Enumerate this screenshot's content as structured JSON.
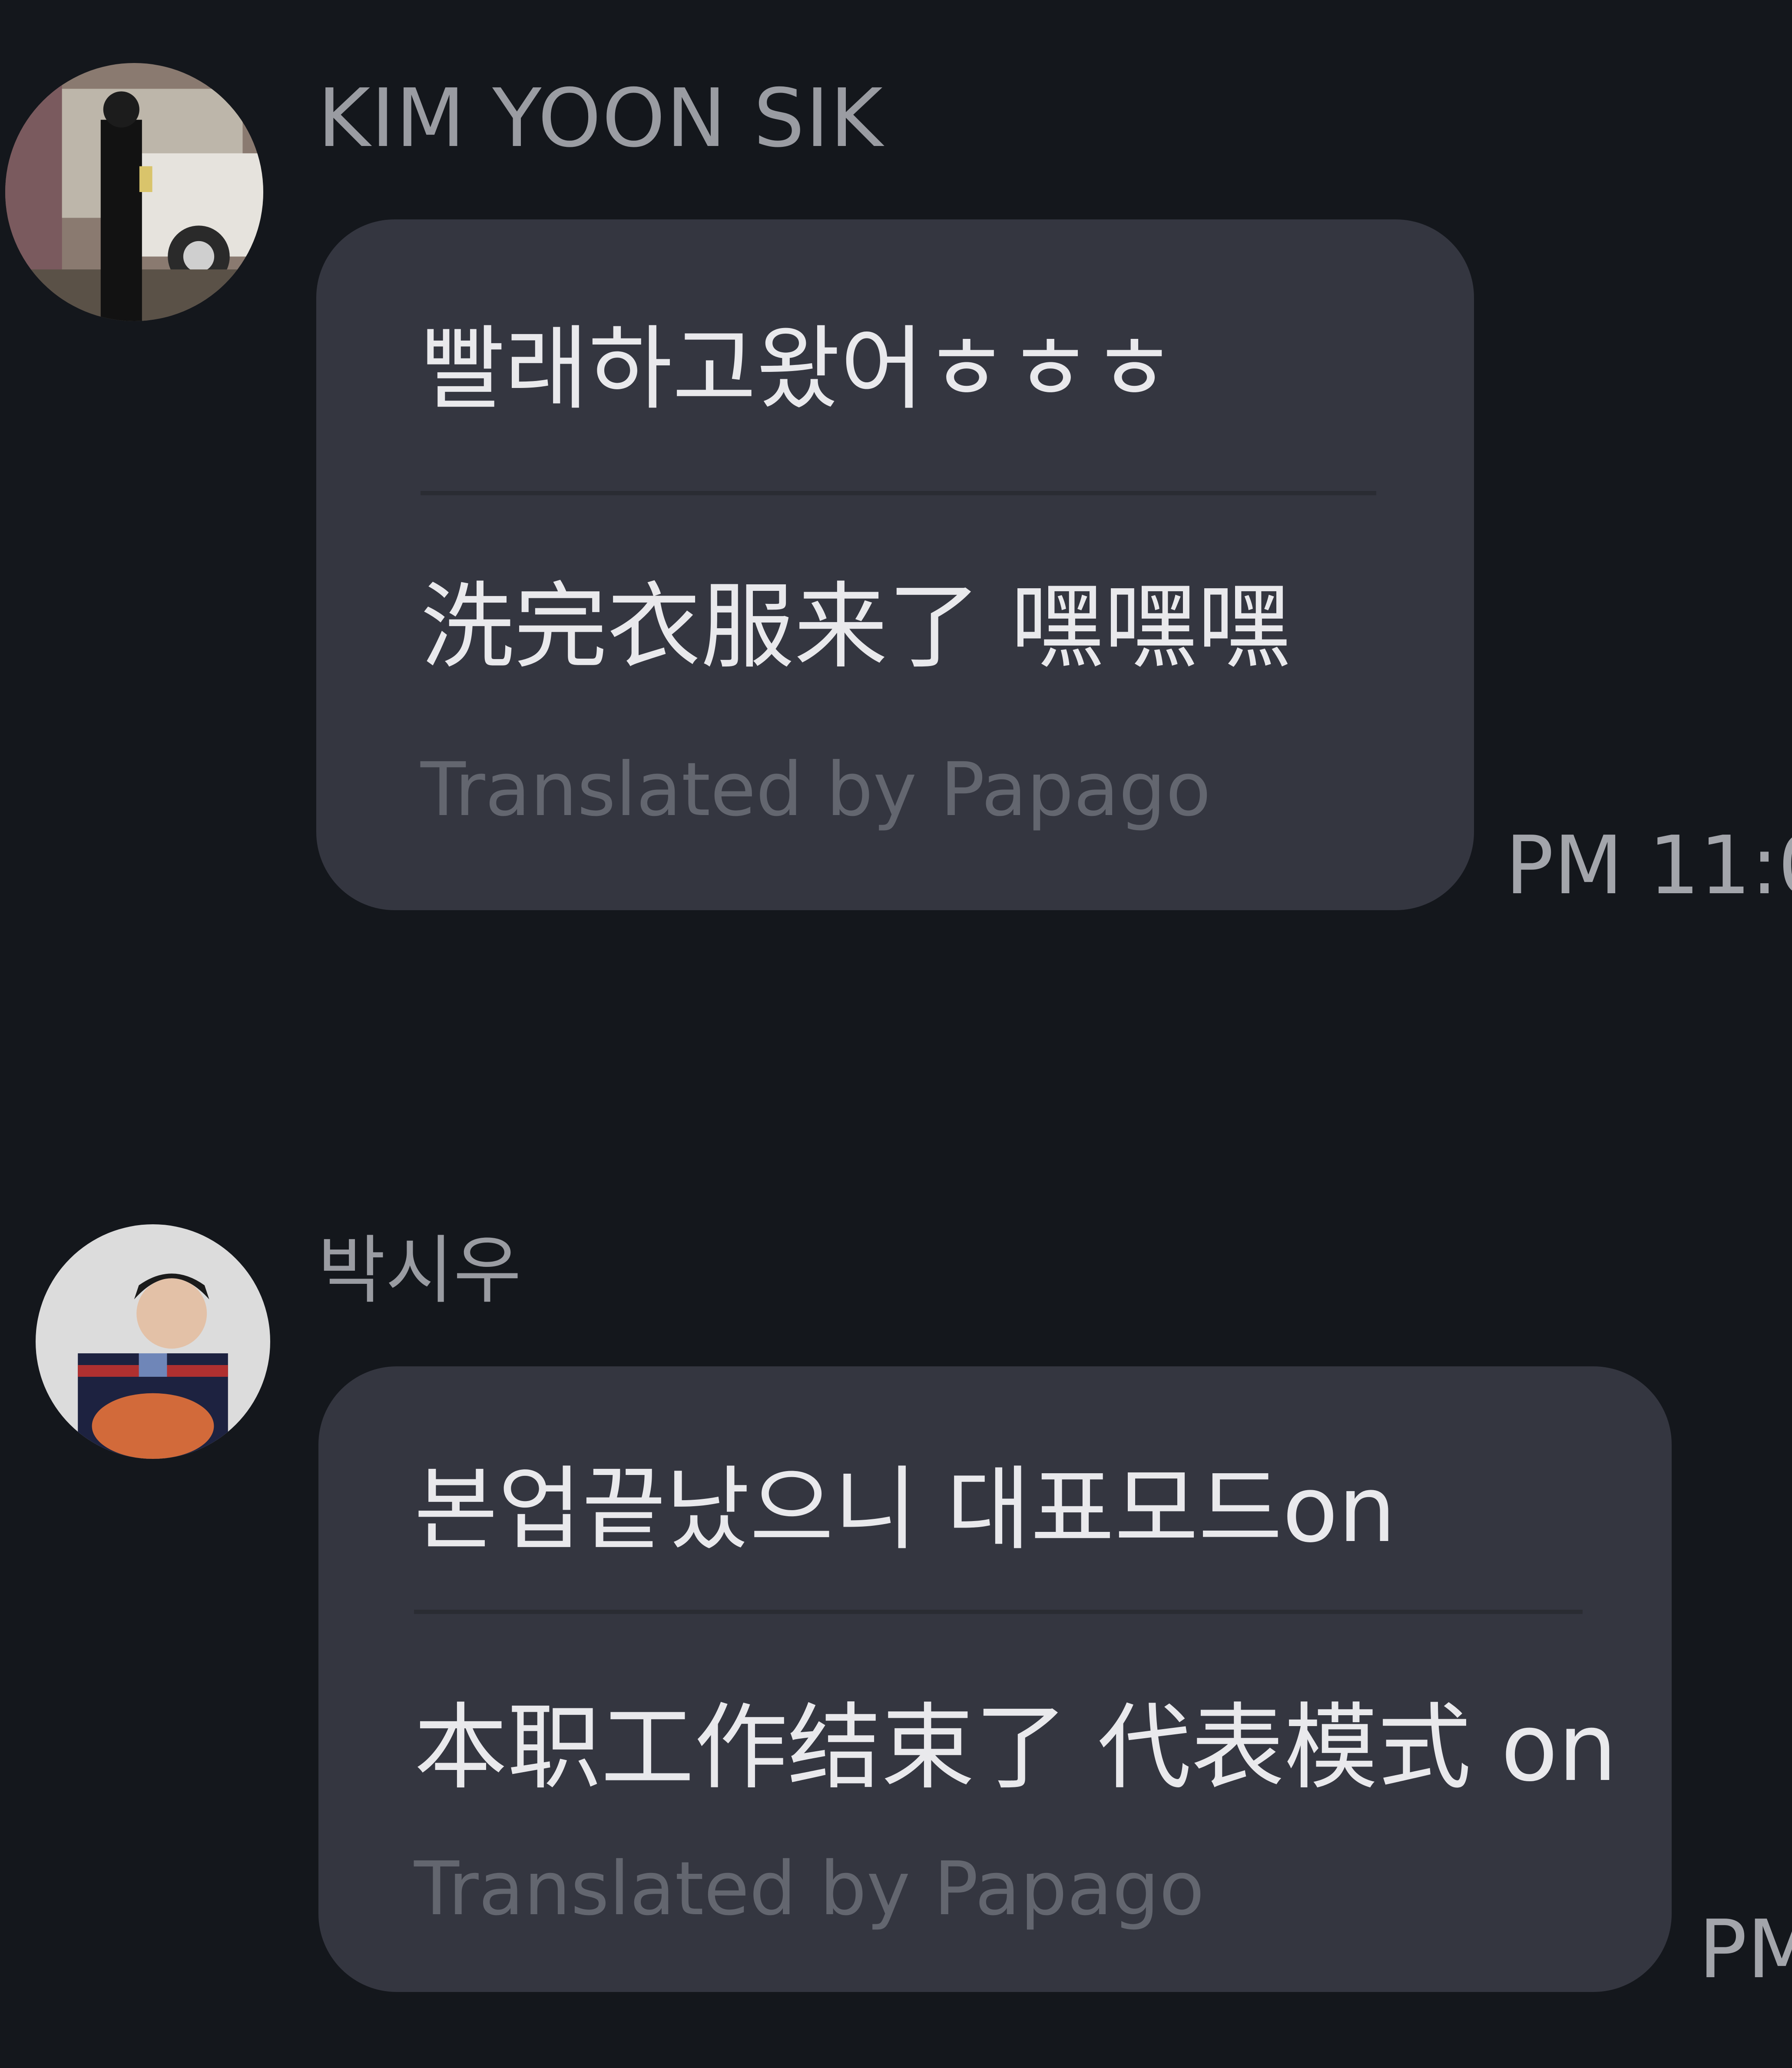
{
  "messages": [
    {
      "sender": "KIM YOON SIK",
      "avatar": "profile-photo",
      "original": "빨래하고왔어ㅎㅎㅎ",
      "translation": "洗完衣服来了 嘿嘿嘿",
      "credit": "Translated by Papago",
      "time": "PM 11:0"
    },
    {
      "sender": "박시우",
      "avatar": "profile-photo",
      "original": "본업끝났으니 대표모드on",
      "translation": "本职工作结束了 代表模式 on",
      "credit": "Translated by Papago",
      "time": "PM"
    }
  ],
  "colors": {
    "background": "#14171c",
    "bubble": "#343640",
    "text": "#e9e9ec",
    "secondary_text": "#9a9ca2",
    "credit_text": "#63666f"
  }
}
